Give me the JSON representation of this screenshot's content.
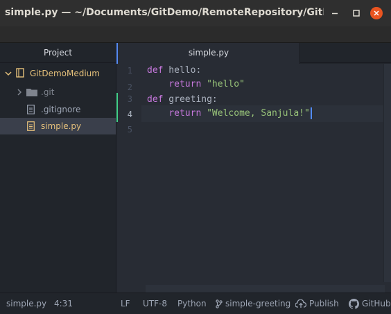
{
  "window": {
    "title": "simple.py — ~/Documents/GitDemo/RemoteRepository/GitD..."
  },
  "panel": {
    "header": "Project"
  },
  "tab": {
    "label": "simple.py"
  },
  "tree": {
    "root": "GitDemoMedium",
    "items": [
      {
        "label": ".git"
      },
      {
        "label": ".gitignore"
      },
      {
        "label": "simple.py"
      }
    ]
  },
  "editor": {
    "line_numbers": [
      "1",
      "2",
      "3",
      "4",
      "5"
    ],
    "lines": [
      {
        "kw": "def",
        "rest": " hello:"
      },
      {
        "indent": "    ",
        "kw": "return",
        "str": " \"hello\""
      },
      {
        "kw": "def",
        "rest": " greeting:"
      },
      {
        "indent": "    ",
        "kw": "return",
        "str": " \"Welcome, Sanjula!\""
      }
    ]
  },
  "status": {
    "file": "simple.py",
    "cursor": "4:31",
    "line_ending": "LF",
    "encoding": "UTF-8",
    "grammar": "Python",
    "branch": "simple-greeting",
    "publish": "Publish",
    "github": "GitHub"
  },
  "colors": {
    "accent": "#568af2",
    "keyword": "#c678dd",
    "string": "#98c379",
    "folder_label": "#e5c07b",
    "close_button": "#e95420",
    "git_added": "#43d08a"
  }
}
